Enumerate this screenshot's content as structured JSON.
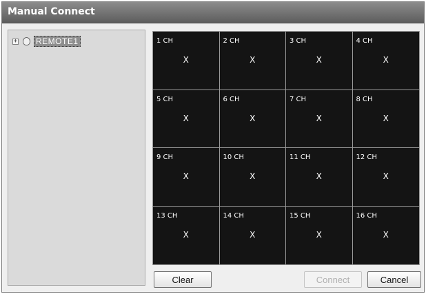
{
  "window": {
    "title": "Manual Connect"
  },
  "tree": {
    "expander_glyph": "+",
    "nodes": [
      {
        "label": "REMOTE1",
        "icon": "camera-node-icon"
      }
    ]
  },
  "channels": [
    {
      "label": "1 CH",
      "mark": "X"
    },
    {
      "label": "2 CH",
      "mark": "X"
    },
    {
      "label": "3 CH",
      "mark": "X"
    },
    {
      "label": "4 CH",
      "mark": "X"
    },
    {
      "label": "5 CH",
      "mark": "X"
    },
    {
      "label": "6 CH",
      "mark": "X"
    },
    {
      "label": "7 CH",
      "mark": "X"
    },
    {
      "label": "8 CH",
      "mark": "X"
    },
    {
      "label": "9 CH",
      "mark": "X"
    },
    {
      "label": "10 CH",
      "mark": "X"
    },
    {
      "label": "11 CH",
      "mark": "X"
    },
    {
      "label": "12 CH",
      "mark": "X"
    },
    {
      "label": "13 CH",
      "mark": "X"
    },
    {
      "label": "14 CH",
      "mark": "X"
    },
    {
      "label": "15 CH",
      "mark": "X"
    },
    {
      "label": "16 CH",
      "mark": "X"
    }
  ],
  "buttons": {
    "clear": "Clear",
    "connect": "Connect",
    "cancel": "Cancel"
  },
  "colors": {
    "titlebar": "#6e6e6e",
    "grid_background": "#141414",
    "tree_background": "#dadada"
  }
}
